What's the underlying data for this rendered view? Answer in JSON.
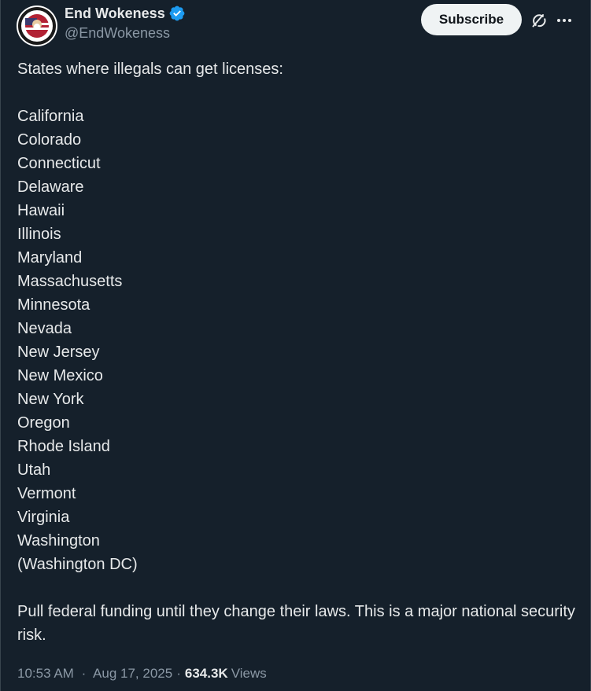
{
  "author": {
    "display_name": "End Wokeness",
    "handle": "@EndWokeness",
    "verified": true
  },
  "header": {
    "subscribe_label": "Subscribe"
  },
  "post": {
    "intro": "States where illegals can get licenses:",
    "states": [
      "California",
      "Colorado",
      "Connecticut",
      "Delaware",
      "Hawaii",
      "Illinois",
      "Maryland",
      "Massachusetts",
      "Minnesota",
      "Nevada",
      "New Jersey",
      "New Mexico",
      "New York",
      "Oregon",
      "Rhode Island",
      "Utah",
      "Vermont",
      "Virginia",
      "Washington",
      "(Washington DC)"
    ],
    "closing": "Pull federal funding until they change their laws. This is a major national security risk."
  },
  "meta": {
    "time": "10:53 AM",
    "date": "Aug 17, 2025",
    "separator": "·",
    "views_count": "634.3K",
    "views_label": "Views"
  },
  "icons": {
    "verified": "verified-badge-icon",
    "grok": "grok-icon",
    "more": "more-icon"
  },
  "colors": {
    "background": "#15202b",
    "text": "#e7e9ea",
    "secondary_text": "#8b98a5",
    "verified_blue": "#1d9bf0",
    "subscribe_bg": "#eff3f4"
  }
}
